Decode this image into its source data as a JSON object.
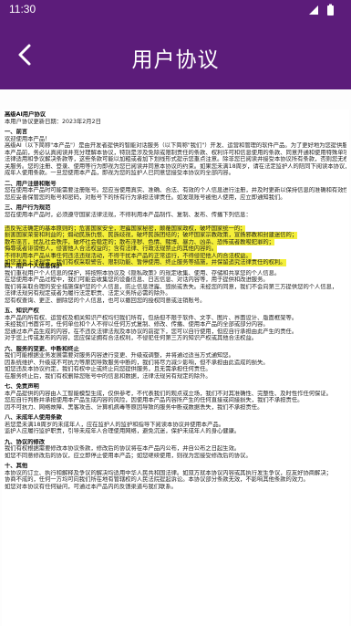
{
  "status_bar": {
    "time": "11:30"
  },
  "header": {
    "title": "用户协议",
    "back_icon": "chevron-left-icon"
  },
  "document": {
    "lines": [
      {
        "text": "高级AI用户协议",
        "style": "head"
      },
      {
        "text": "本用户协议更新日期：2023年2月2日",
        "style": "normal"
      },
      {
        "text": "",
        "style": "gap"
      },
      {
        "text": "一、前言",
        "style": "head"
      },
      {
        "text": "欢迎使用本产品！",
        "style": "normal"
      },
      {
        "text": "高级AI（以下简称\"本产品\"）是由开发者提供的智能对话服务（以下简称\"我们\"）开发、运营和管理的软件产品。为了更好地为您提供服务，请您在使用",
        "style": "normal"
      },
      {
        "text": "本产品前，务必认真阅读并充分理解本协议，特别是涉及免除或限制责任的条款、权利许可和信息使用的条款、同意开通和使用特殊单项服务的条款、",
        "style": "normal"
      },
      {
        "text": "法律适用和争议解决条款等，这些条款可能以加粗或者加下划线形式提示您重点注意。除非您已阅读并接受本协议所有条款，否则您无权使用本产品及相",
        "style": "normal"
      },
      {
        "text": "关服务。您的注册、登录、使用等行为即视为您已阅读并同意本协议的约束。如果您未满18周岁，请在法定监护人的陪同下阅读本协议，并特别注意未",
        "style": "normal"
      },
      {
        "text": "成年人使用条款。一旦您使用本产品，即视为您的监护人已同意您接受本协议的全部内容。",
        "style": "normal"
      },
      {
        "text": "",
        "style": "gap"
      },
      {
        "text": "二、用户注册和账号",
        "style": "head"
      },
      {
        "text": "您在使用本产品时可能需要注册账号。您应当使用真实、准确、合法、有效的个人信息进行注册，并及时更新以保持信息的准确和有效性。",
        "style": "normal"
      },
      {
        "text": "您应妥善保管您的账号和密码，对账号下的所有行为承担法律责任。如发现账号被他人使用，应立即通知我们。",
        "style": "normal"
      },
      {
        "text": "",
        "style": "gap"
      },
      {
        "text": "三、用户行为规范",
        "style": "head"
      },
      {
        "text": "您在使用本产品时，必须遵守国家法律法规，不得利用本产品制作、复制、发布、传播下列信息：",
        "style": "normal"
      },
      {
        "text": "违反宪法确定的基本原则的；危害国家安全，泄露国家秘密，颠覆国家政权，破坏国家统一的；",
        "style": "hl"
      },
      {
        "text": "损害国家荣誉和利益的；煽动民族仇恨、民族歧视，破坏民族团结的；破坏国家宗教政策，宣扬邪教和封建迷信的；",
        "style": "hl"
      },
      {
        "text": "散布谣言，扰乱社会秩序，破坏社会稳定的；散布淫秽、色情、赌博、暴力、凶杀、恐怖或者教唆犯罪的；",
        "style": "hl"
      },
      {
        "text": "侮辱或者诽谤他人，侵害他人合法权益的；含有法律、行政法规禁止的其他内容的。",
        "style": "hl"
      },
      {
        "text": "不得利用本产品从事任何违法违规活动，不得干扰本产品的正常运行，不得侵犯他人的合法权益。",
        "style": "hl"
      },
      {
        "text": "如您违反上述规定，我们有权采取警告、限制功能、暂停使用、终止服务等措施，并保留追究法律责任的权利。",
        "style": "hl"
      },
      {
        "text": "",
        "style": "gap"
      },
      {
        "text": "四、用户个人信息保护",
        "style": "head"
      },
      {
        "text": "我们重视用户个人信息的保护，将按照本协议及《隐私政策》的规定收集、使用、存储和共享您的个人信息。",
        "style": "normal"
      },
      {
        "text": "在您使用本产品过程中，我们可能会收集您的设备信息、日志信息、对话内容等，用于提供和改进服务。",
        "style": "normal"
      },
      {
        "text": "我们将采取合理的安全措施保护您的个人信息，防止信息泄露、毁损或丢失。未经您的同意，我们不会向第三方提供您的个人信息，",
        "style": "normal"
      },
      {
        "text": "法律法规另有规定或者为履行法定职责、法定义务所必需的除外。",
        "style": "normal"
      },
      {
        "text": "您有权查询、更正、删除您的个人信息，也可以撤回您的授权同意或注销账号。",
        "style": "normal"
      },
      {
        "text": "",
        "style": "gap"
      },
      {
        "text": "五、知识产权",
        "style": "head"
      },
      {
        "text": "本产品的所有权、运营权及相关知识产权均归我们所有，包括但不限于软件、文字、图片、界面设计、版面框架等。",
        "style": "normal"
      },
      {
        "text": "未经我们书面许可，任何单位和个人不得以任何方式复制、修改、传播、使用本产品的全部或部分内容。",
        "style": "normal"
      },
      {
        "text": "您通过本产品生成的内容，在不违反法律法规及本协议的前提下，您可以自行使用，但应自行承担由此产生的责任。",
        "style": "normal"
      },
      {
        "text": "对于您上传或发布的内容，您应保证拥有合法权利，不侵犯任何第三方的知识产权或其他合法权益。",
        "style": "normal"
      },
      {
        "text": "",
        "style": "gap"
      },
      {
        "text": "六、服务的变更、中断和终止",
        "style": "head"
      },
      {
        "text": "我们可能根据业务发展需要对服务内容进行变更、升级或调整，并将通过适当方式通知您。",
        "style": "normal"
      },
      {
        "text": "因系统维护、升级或不可抗力等原因导致服务中断的，我们将尽力减少影响，但不承担由此造成的损失。",
        "style": "normal"
      },
      {
        "text": "如您违反本协议约定，我们有权中止或终止向您提供服务，且无需承担任何责任。",
        "style": "normal"
      },
      {
        "text": "在服务终止后，我们有权删除您账号中的信息和数据，法律法规另有规定的除外。",
        "style": "normal"
      },
      {
        "text": "",
        "style": "gap"
      },
      {
        "text": "七、免责声明",
        "style": "head"
      },
      {
        "text": "本产品提供的内容由人工智能模型生成，仅供参考，不代表我们的观点或立场，我们不对其准确性、完整性、及时性作任何保证。",
        "style": "normal"
      },
      {
        "text": "您应自行判断并承担使用本产品生成内容的风险，因使用本产品内容所产生的任何直接或间接损失，我们不承担责任。",
        "style": "normal"
      },
      {
        "text": "因不可抗力、网络故障、黑客攻击、计算机病毒等原因导致的服务中断或数据丢失，我们不承担责任。",
        "style": "normal"
      },
      {
        "text": "",
        "style": "gap"
      },
      {
        "text": "八、未成年人使用条款",
        "style": "head"
      },
      {
        "text": "若您是未满18周岁的未成年人，应在监护人的监护和指导下阅读本协议并使用本产品。",
        "style": "normal"
      },
      {
        "text": "监护人应履行监护职责，引导未成年人合理使用网络，避免沉迷，保护未成年人的身心健康。",
        "style": "normal"
      },
      {
        "text": "",
        "style": "gap"
      },
      {
        "text": "九、协议的修改",
        "style": "head"
      },
      {
        "text": "我们有权根据需要修改本协议条款，修改后的协议将在本产品内公布，并自公布之日起生效。",
        "style": "normal"
      },
      {
        "text": "如您不同意修改后的协议，应立即停止使用本产品；如您继续使用，则视为您接受修改后的协议。",
        "style": "normal"
      },
      {
        "text": "",
        "style": "gap"
      },
      {
        "text": "十、其他",
        "style": "head"
      },
      {
        "text": "本协议的订立、执行和解释及争议的解决均适用中华人民共和国法律。如双方就本协议内容或其执行发生争议，应友好协商解决；",
        "style": "normal"
      },
      {
        "text": "协商不成的，任何一方均可向我们所在地有管辖权的人民法院提起诉讼。本协议部分条款无效，不影响其他条款的效力。",
        "style": "normal"
      },
      {
        "text": "如您对本协议有任何疑问，可通过本产品内的反馈渠道与我们联系。",
        "style": "normal"
      }
    ]
  }
}
